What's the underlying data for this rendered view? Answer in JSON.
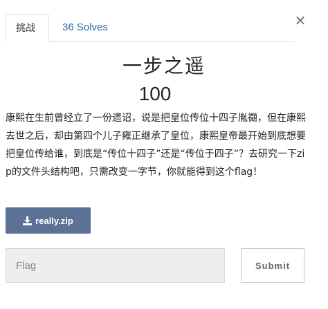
{
  "tabs": [
    {
      "label": "挑战"
    },
    {
      "label": "36 Solves"
    }
  ],
  "close_glyph": "×",
  "challenge": {
    "title": "一步之遥",
    "value": "100",
    "description": "康熙在生前曾经立了一份遗诏，说是把皇位传位十四子胤禵，但在康熙去世之后，却由第四个儿子雍正继承了皇位，康熙皇帝最开始到底想要把皇位传给谁，到底是“传位十四子”还是“传位于四子”？去研究一下zip的文件头结构吧，只需改变一字节，你就能得到这个flag！"
  },
  "download": {
    "label": "really.zip",
    "icon": "download-icon"
  },
  "flag": {
    "placeholder": "Flag",
    "value": ""
  },
  "submit_label": "Submit",
  "colors": {
    "accent": "#5b7296",
    "link": "#2b6fad",
    "input_bg": "#eeeeee"
  }
}
